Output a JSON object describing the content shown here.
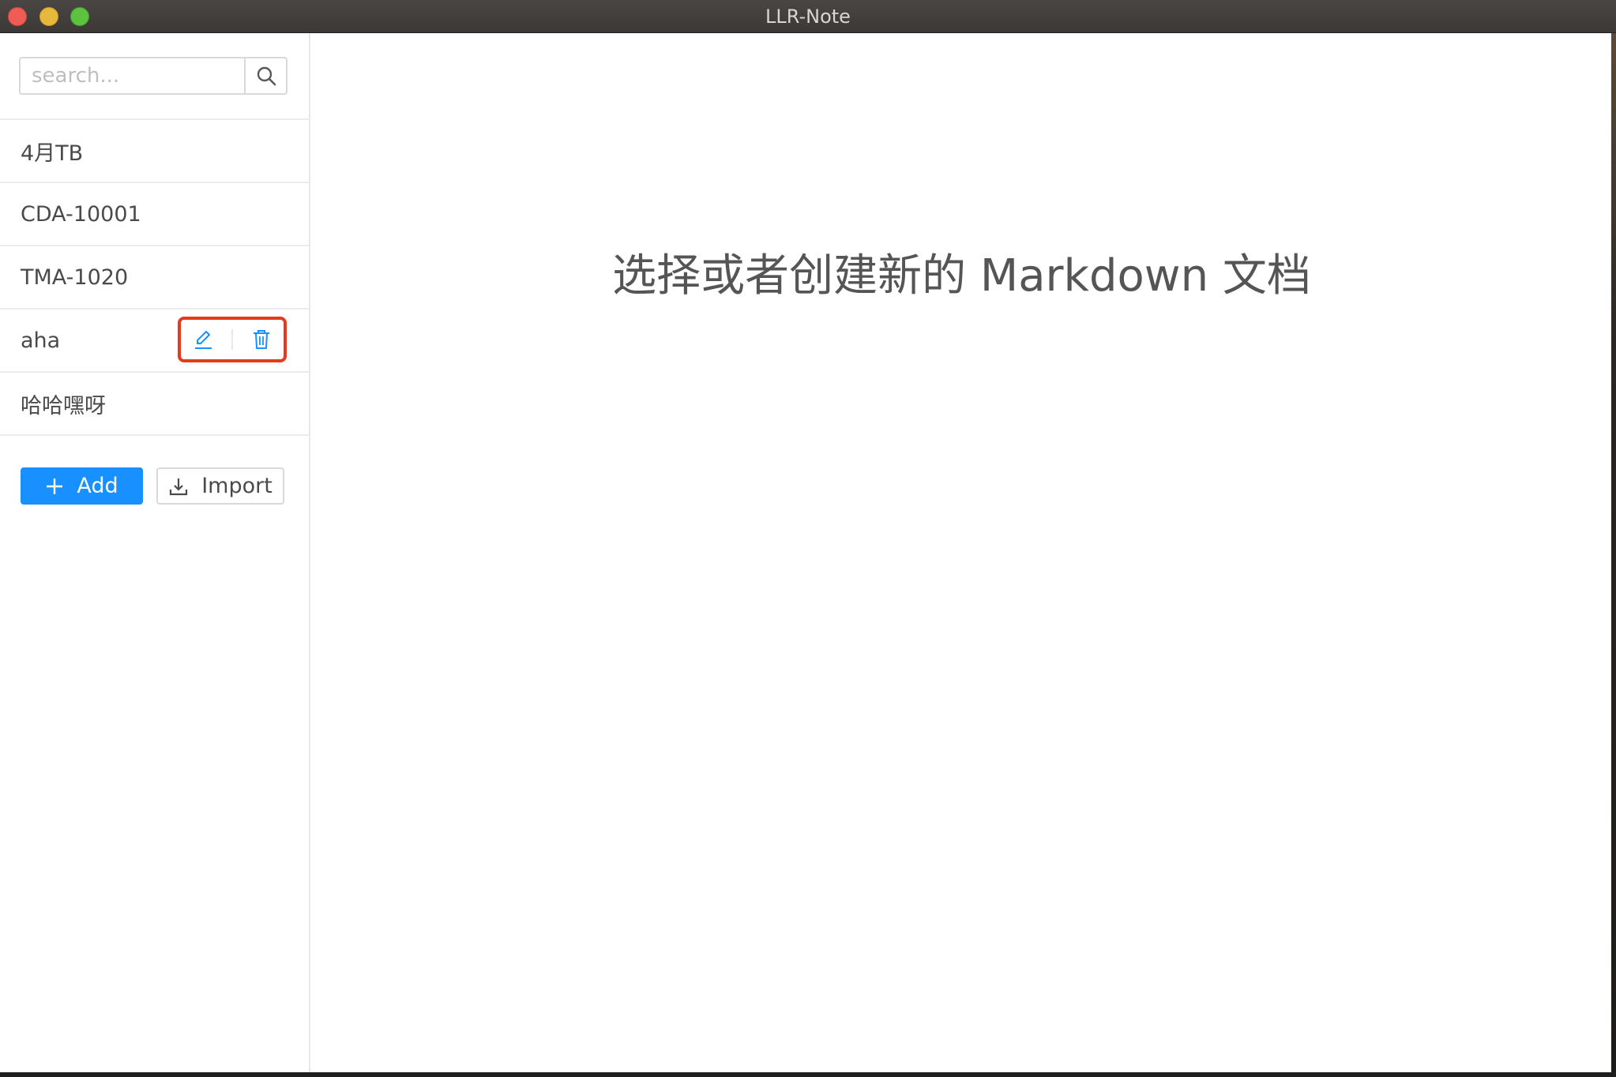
{
  "window": {
    "title": "LLR-Note"
  },
  "sidebar": {
    "search": {
      "placeholder": "search...",
      "value": ""
    },
    "files": [
      {
        "title": "4月TB"
      },
      {
        "title": "CDA-10001"
      },
      {
        "title": "TMA-1020"
      },
      {
        "title": "aha"
      },
      {
        "title": "哈哈嘿呀"
      }
    ],
    "buttons": {
      "add_label": "Add",
      "import_label": "Import"
    }
  },
  "main": {
    "placeholder": "选择或者创建新的 Markdown 文档"
  },
  "colors": {
    "primary": "#1890ff",
    "highlight_border": "#e63a1f"
  },
  "icons": {
    "search": "search-icon",
    "edit": "edit-icon",
    "delete": "delete-icon",
    "add": "plus-icon",
    "import": "import-icon"
  }
}
